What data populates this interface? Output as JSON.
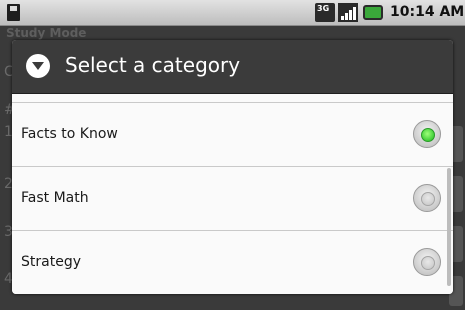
{
  "status_bar": {
    "network_label": "3G",
    "time": "10:14 AM",
    "icons": [
      "sd-card-icon",
      "network-3g-icon",
      "signal-icon",
      "battery-icon"
    ]
  },
  "background_app": {
    "title": "Study Mode",
    "rows": [
      "C",
      "#",
      "1",
      "2",
      "3",
      "4"
    ]
  },
  "dialog": {
    "title": "Select a category",
    "header_icon": "dropdown-circle-icon",
    "items": [
      {
        "label": "Facts to Know",
        "checked": true
      },
      {
        "label": "Fast Math",
        "checked": false
      },
      {
        "label": "Strategy",
        "checked": false
      }
    ]
  },
  "colors": {
    "header_bg": "#3b3b3b",
    "radio_selected": "#19b91c",
    "dialog_bg": "#fafafa"
  }
}
